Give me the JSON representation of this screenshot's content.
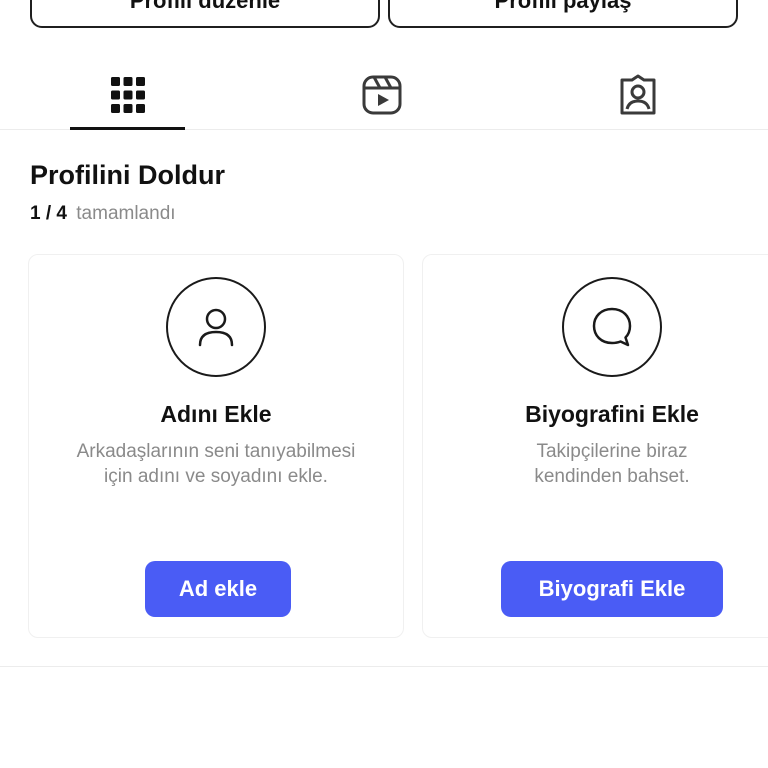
{
  "top_buttons": {
    "edit_label": "Profili düzenle",
    "share_label": "Profili paylaş"
  },
  "tabs": [
    {
      "icon": "grid-icon",
      "selected": true
    },
    {
      "icon": "reels-icon",
      "selected": false
    },
    {
      "icon": "tagged-icon",
      "selected": false
    }
  ],
  "complete_profile": {
    "title": "Profilini Doldur",
    "progress_count": "1 / 4",
    "progress_label": "tamamlandı"
  },
  "cards": [
    {
      "icon": "person-icon",
      "title": "Adını Ekle",
      "description_line1": "Arkadaşlarının seni tanıyabilmesi",
      "description_line2": "için adını ve soyadını ekle.",
      "button_label": "Ad ekle"
    },
    {
      "icon": "speech-bubble-icon",
      "title": "Biyografini Ekle",
      "description_line1": "Takipçilerine biraz",
      "description_line2": "kendinden bahset.",
      "button_label": "Biyografi Ekle"
    }
  ],
  "colors": {
    "accent": "#4a5cf5",
    "muted_text": "#8a8a8a"
  }
}
